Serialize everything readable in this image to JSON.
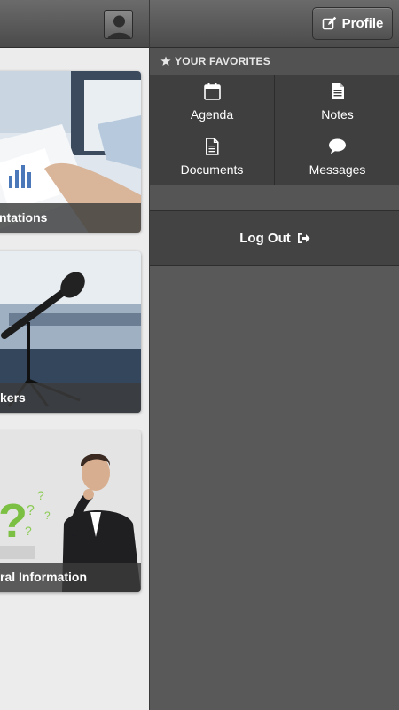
{
  "main": {
    "tiles": [
      {
        "label": "ntations"
      },
      {
        "label": "kers"
      },
      {
        "label": "ral Information"
      }
    ]
  },
  "drawer": {
    "profile_label": "Profile",
    "favorites_heading": "YOUR FAVORITES",
    "favorites": [
      {
        "label": "Agenda",
        "icon": "calendar-icon"
      },
      {
        "label": "Notes",
        "icon": "notes-icon"
      },
      {
        "label": "Documents",
        "icon": "document-icon"
      },
      {
        "label": "Messages",
        "icon": "chat-bubble-icon"
      }
    ],
    "logout_label": "Log Out"
  },
  "colors": {
    "drawer_bg": "#595959",
    "tile_cell_bg": "#3f3f3f",
    "main_bg": "#ececec"
  }
}
